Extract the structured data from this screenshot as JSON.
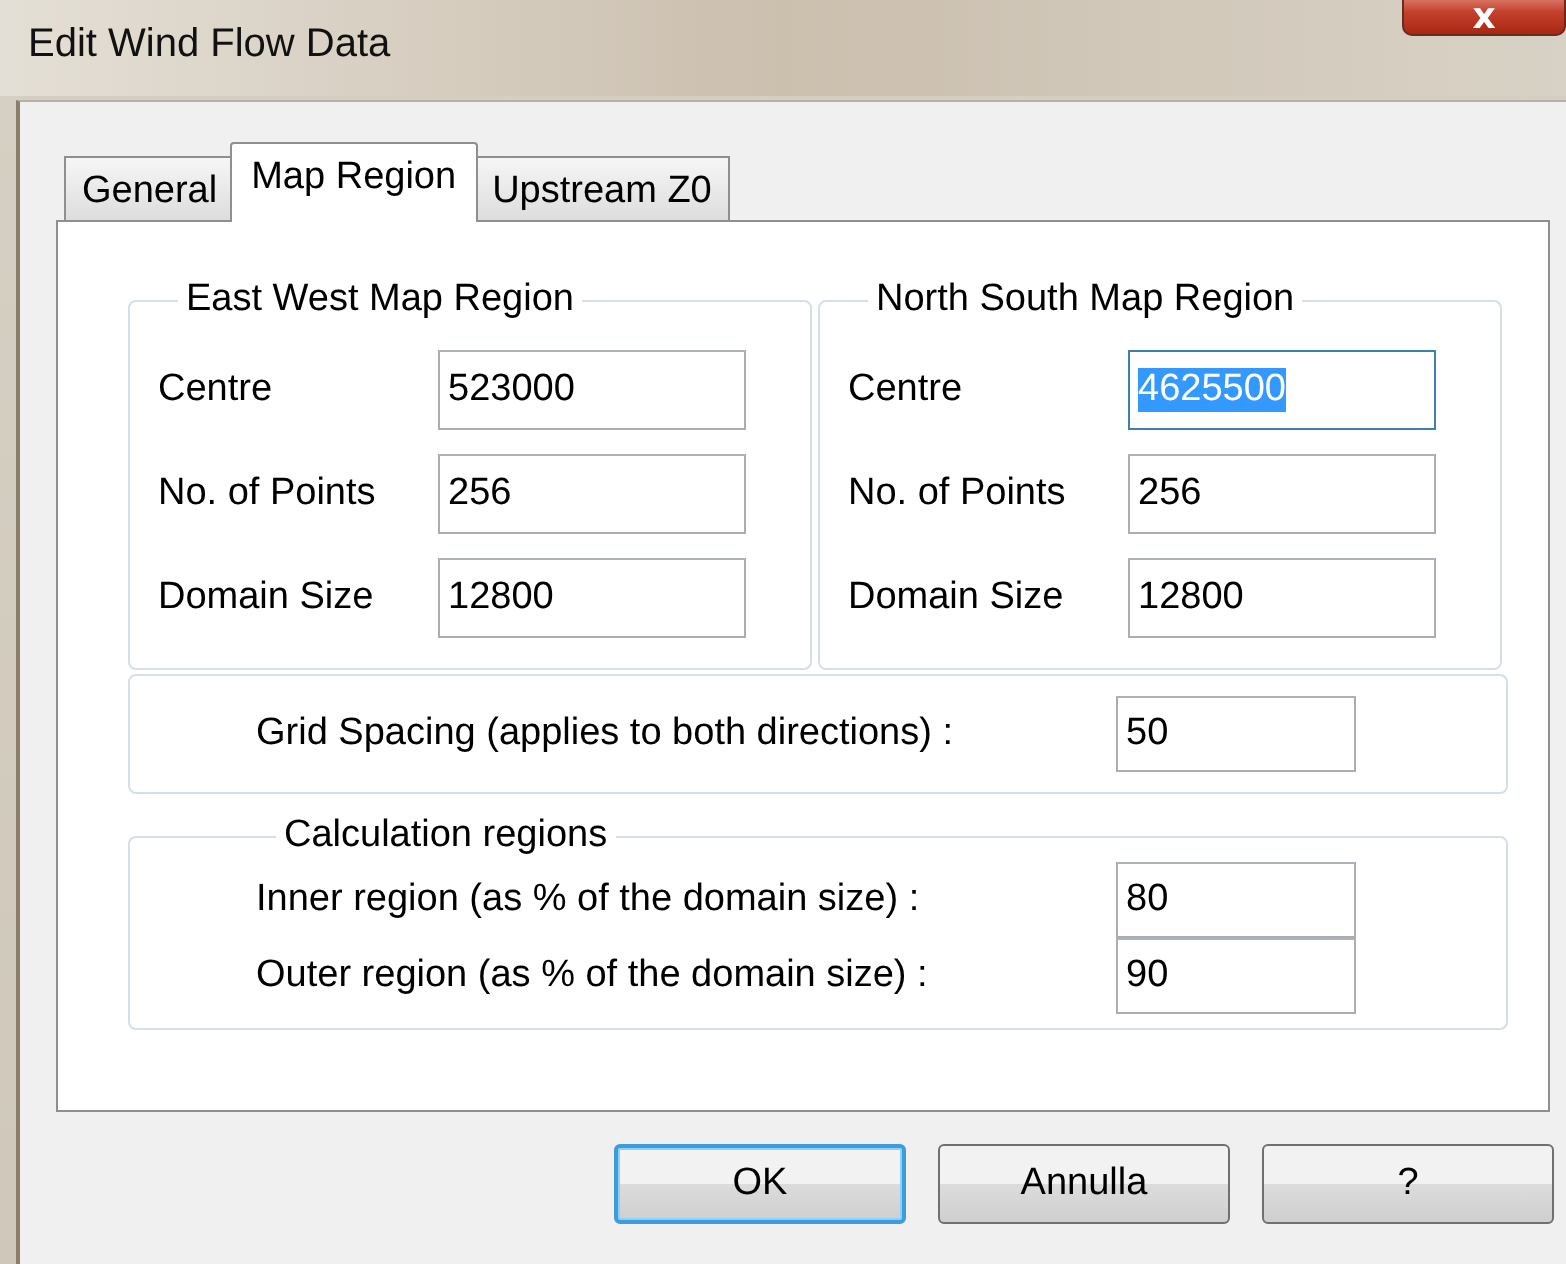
{
  "window": {
    "title": "Edit Wind Flow Data",
    "close_label": "x"
  },
  "tabs": [
    {
      "label": "General",
      "selected": false
    },
    {
      "label": "Map Region",
      "selected": true
    },
    {
      "label": "Upstream Z0",
      "selected": false
    }
  ],
  "groups": [
    {
      "title": "East West Map Region",
      "fields": [
        {
          "label": "Centre",
          "value": "523000",
          "text_selected": false
        },
        {
          "label": "No. of Points",
          "value": "256",
          "text_selected": false
        },
        {
          "label": "Domain Size",
          "value": "12800",
          "text_selected": false
        }
      ]
    },
    {
      "title": "North South Map Region",
      "fields": [
        {
          "label": "Centre",
          "value": "4625500",
          "text_selected": true
        },
        {
          "label": "No. of Points",
          "value": "256",
          "text_selected": false
        },
        {
          "label": "Domain Size",
          "value": "12800",
          "text_selected": false
        }
      ]
    }
  ],
  "grid_spacing": {
    "label": "Grid Spacing (applies to both directions) :",
    "value": "50"
  },
  "calculation_regions": {
    "title": "Calculation regions",
    "fields": [
      {
        "label": "Inner region (as % of the domain size) :",
        "value": "80"
      },
      {
        "label": "Outer region (as % of the domain size) :",
        "value": "90"
      }
    ]
  },
  "buttons": [
    {
      "label": "OK",
      "default": true
    },
    {
      "label": "Annulla",
      "default": false
    },
    {
      "label": "?",
      "default": false
    }
  ]
}
